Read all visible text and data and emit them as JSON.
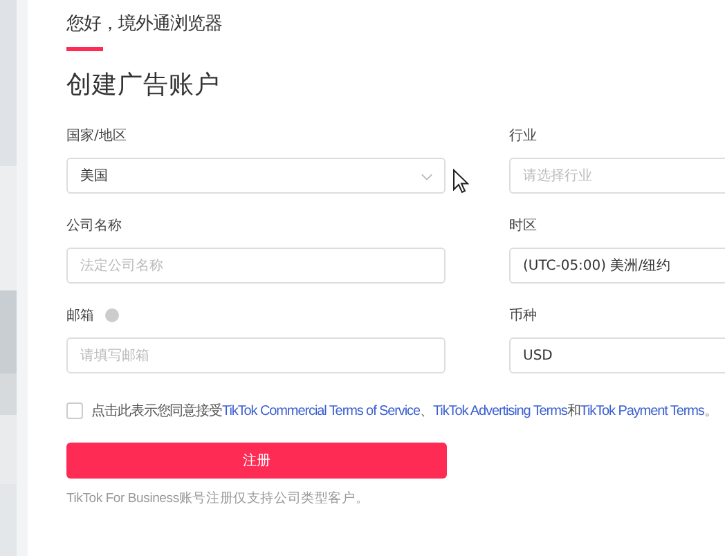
{
  "greeting": {
    "label": "您好，境外通浏览器",
    "selected": true
  },
  "heading": "创建广告账户",
  "fields": [
    {
      "label": "国家/地区",
      "kind": "select",
      "value": "美国",
      "help": false
    },
    {
      "label": "行业",
      "kind": "select",
      "placeholder": "请选择行业",
      "help": false
    },
    {
      "label": "公司名称",
      "kind": "text",
      "placeholder": "法定公司名称",
      "help": false
    },
    {
      "label": "时区",
      "kind": "select",
      "value": "(UTC-05:00) 美洲/纽约",
      "help": false
    },
    {
      "label": "邮箱",
      "kind": "text",
      "placeholder": "请填写邮箱",
      "help": true
    },
    {
      "label": "币种",
      "kind": "select",
      "value": "USD",
      "help": false
    }
  ],
  "agreement": {
    "checked": false,
    "parts": [
      {
        "kind": "text",
        "text": "点击此表示您同意接受"
      },
      {
        "kind": "link",
        "text": "TikTok Commercial Terms of Service"
      },
      {
        "kind": "text",
        "text": "、"
      },
      {
        "kind": "link",
        "text": "TikTok Advertising Terms"
      },
      {
        "kind": "text",
        "text": "和"
      },
      {
        "kind": "link",
        "text": "TikTok Payment Terms"
      },
      {
        "kind": "text",
        "text": "。"
      }
    ]
  },
  "submit": "注册",
  "note": "TikTok For Business账号注册仅支持公司类型客户。"
}
